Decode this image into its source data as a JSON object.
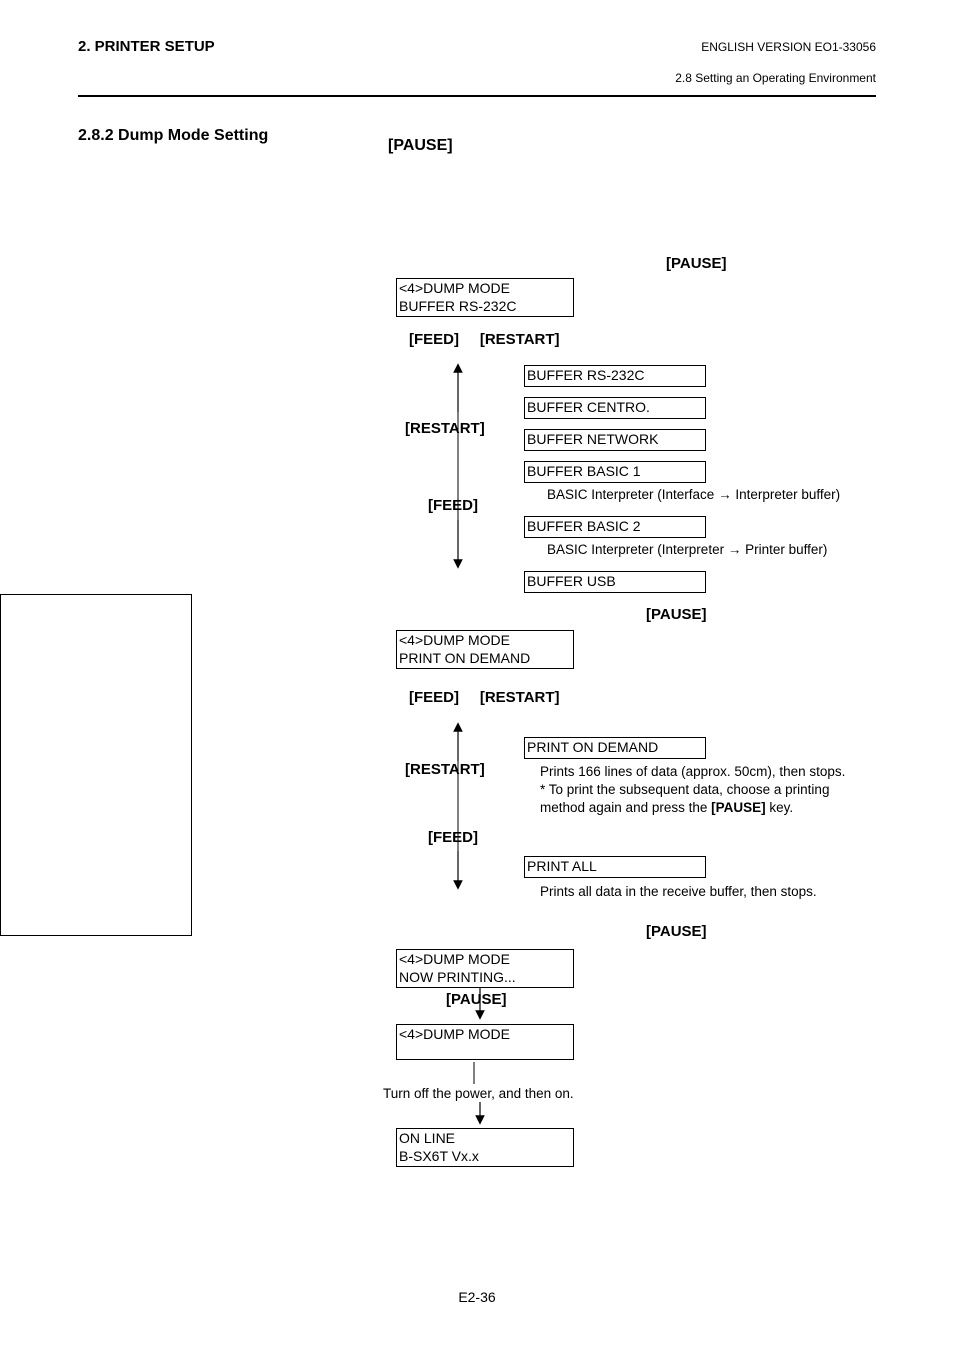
{
  "header": {
    "left": "2. PRINTER SETUP",
    "right_version": "ENGLISH VERSION EO1-33056",
    "sub": "2.8 Setting an Operating Environment"
  },
  "section": {
    "number_title": "2.8.2  Dump Mode Setting"
  },
  "labels": {
    "pause": "[PAUSE]",
    "feed": "[FEED]",
    "restart": "[RESTART]",
    "feed_restart": "[FEED]     [RESTART]"
  },
  "lcd": {
    "dump_buffer_l1": "<4>DUMP MODE",
    "dump_buffer_l2": "BUFFER   RS-232C",
    "buf_rs232c": "BUFFER    RS-232C",
    "buf_centro": "BUFFER    CENTRO.",
    "buf_network": "BUFFER    NETWORK",
    "buf_basic1": "BUFFER    BASIC 1",
    "buf_basic2": "BUFFER    BASIC 2",
    "buf_usb": "BUFFER    USB",
    "dump_print_l1": "<4>DUMP MODE",
    "dump_print_l2": "PRINT   ON DEMAND",
    "print_ondemand": "PRINT   ON DEMAND",
    "print_all": "PRINT   ALL",
    "nowprint_l1": "<4>DUMP MODE",
    "nowprint_l2": "NOW PRINTING...",
    "dumpmode_only": "<4>DUMP MODE",
    "online_l1": "ON LINE",
    "online_l2": "B-SX6T     Vx.x"
  },
  "desc": {
    "basic1": "BASIC Interpreter (Interface → Interpreter buffer)",
    "basic2": "BASIC Interpreter (Interpreter → Printer buffer)",
    "ondemand1": "Prints 166 lines of data (approx. 50cm), then stops.",
    "ondemand2a": "* To print the subsequent data, choose a printing method again and press the ",
    "ondemand2b": "[PAUSE]",
    "ondemand2c": " key.",
    "printall": "Prints all data in the receive buffer, then stops.",
    "poweroff": "Turn off the power, and then on."
  },
  "footer": {
    "pageno": "E2-36"
  }
}
